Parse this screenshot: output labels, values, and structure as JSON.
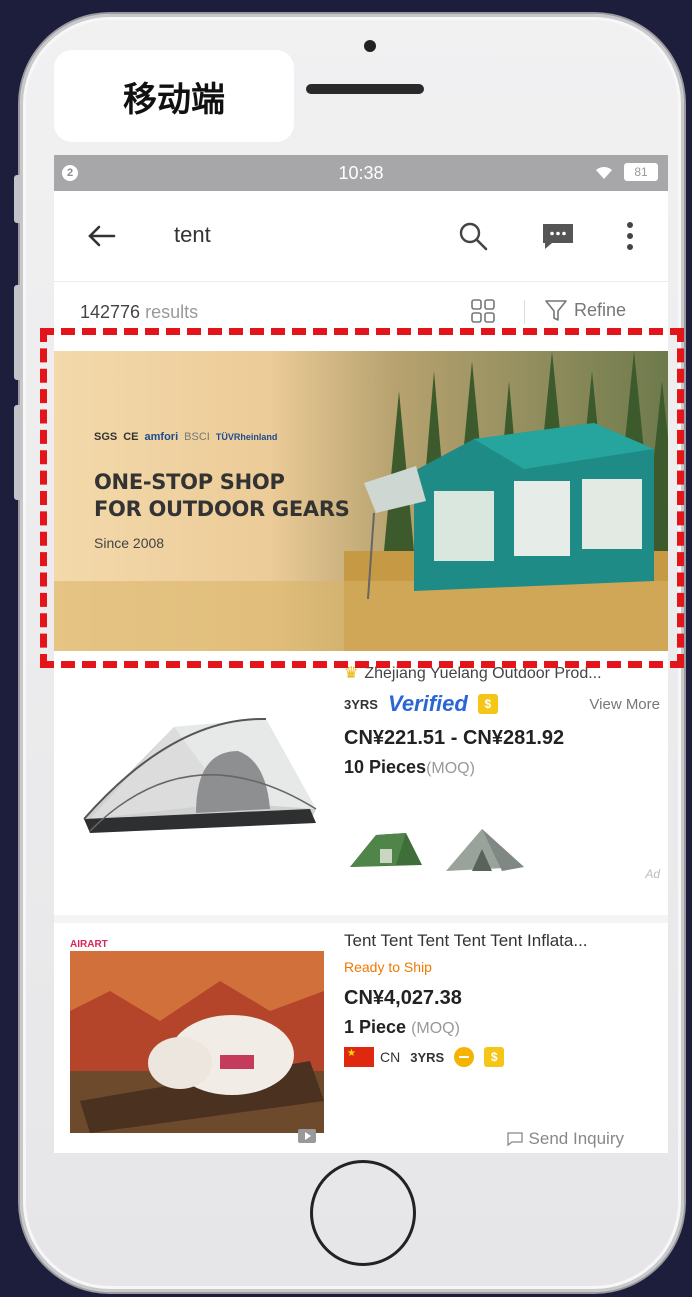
{
  "overlay": {
    "label": "移动端"
  },
  "status_bar": {
    "notification_count": "2",
    "time": "10:38",
    "battery": "81"
  },
  "search_bar": {
    "query": "tent"
  },
  "results_bar": {
    "count": "142776",
    "count_suffix": " results",
    "refine_label": "Refine"
  },
  "banner": {
    "certifications": [
      "SGS",
      "CE",
      "amfori",
      "BSCI",
      "TÜVRheinland"
    ],
    "headline_line1": "ONE-STOP SHOP",
    "headline_line2": "FOR OUTDOOR GEARS",
    "since": "Since 2008"
  },
  "products": [
    {
      "supplier": "Zhejiang Yuelang Outdoor Prod...",
      "years": "3YRS",
      "verified": "Verified",
      "view_more": "View More",
      "price": "CN¥221.51 - CN¥281.92",
      "min_order": "10 Pieces",
      "moq_label": "(MOQ)",
      "ad_label": "Ad"
    },
    {
      "brand_tag": "AIRART",
      "title": "Tent Tent Tent Tent Tent Inflata...",
      "shipping": "Ready to Ship",
      "price": "CN¥4,027.38",
      "min_order": "1 Piece",
      "moq_label": "(MOQ)",
      "country": "CN",
      "years": "3YRS",
      "inquiry_label": "Send Inquiry"
    }
  ],
  "colors": {
    "highlight": "#e4141b",
    "verified": "#2a66d6",
    "ready_to_ship": "#f07800"
  },
  "icons": [
    "back-arrow-icon",
    "search-icon",
    "chat-icon",
    "more-vertical-icon",
    "grid-view-icon",
    "funnel-icon",
    "wifi-icon",
    "play-icon",
    "message-icon"
  ]
}
